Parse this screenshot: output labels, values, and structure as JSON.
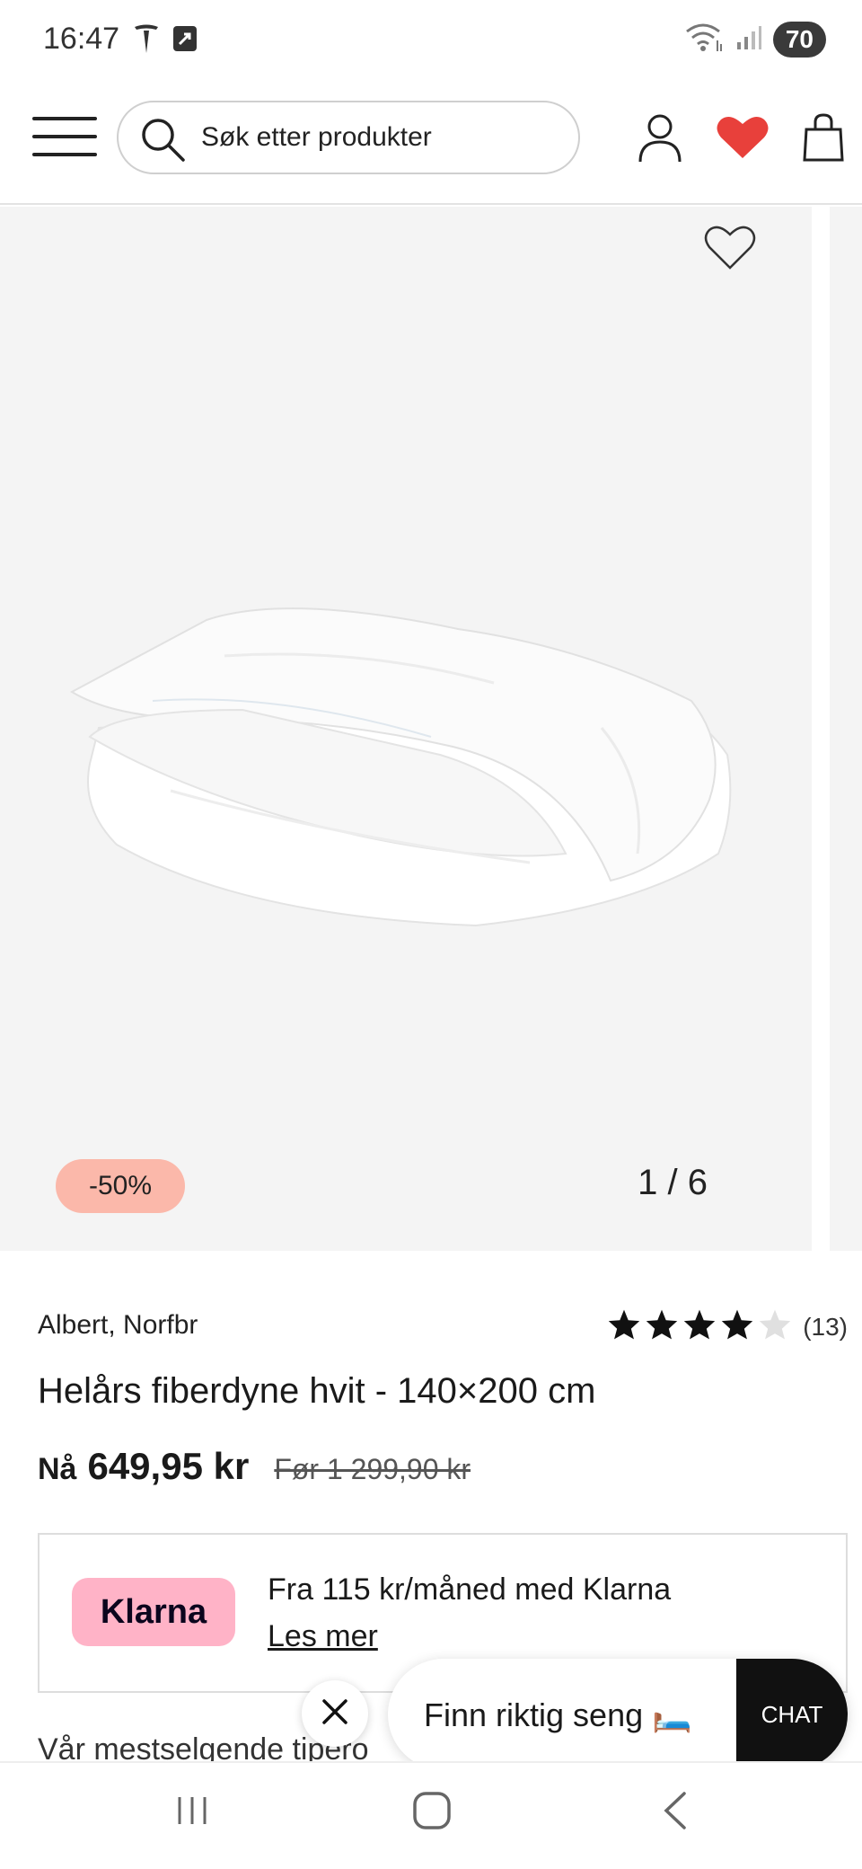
{
  "status_bar": {
    "time": "16:47",
    "battery": "70",
    "icons_left": [
      "tesla-icon",
      "app-notification-icon"
    ],
    "icons_right": [
      "wifi-icon",
      "signal-icon"
    ]
  },
  "header": {
    "search_placeholder": "Søk etter produkter",
    "icons": [
      "menu-icon",
      "search-icon",
      "user-icon",
      "heart-icon",
      "bag-icon"
    ],
    "heart_color": "#e8403b"
  },
  "gallery": {
    "discount_badge": "-50%",
    "pager": "1 / 6",
    "badge_color": "#fbb8aa"
  },
  "product": {
    "brand": "Albert, Norfbr",
    "rating": 4,
    "rating_max": 5,
    "rating_count": "(13)",
    "title": "Helårs fiberdyne hvit - 140×200 cm",
    "price_label": "Nå",
    "price_now": "649,95 kr",
    "price_old": "Før 1 299,90 kr"
  },
  "klarna": {
    "logo": "Klarna",
    "text": "Fra 115 kr/måned med Klarna",
    "link": "Les mer",
    "logo_color": "#ffb3c7"
  },
  "next_section": "Vår mestselgende tipero",
  "chat": {
    "prompt": "Finn riktig seng 🛏️",
    "button": "CHAT"
  },
  "nav_bar": {
    "buttons": [
      "recent-apps-icon",
      "home-icon",
      "back-icon"
    ]
  }
}
